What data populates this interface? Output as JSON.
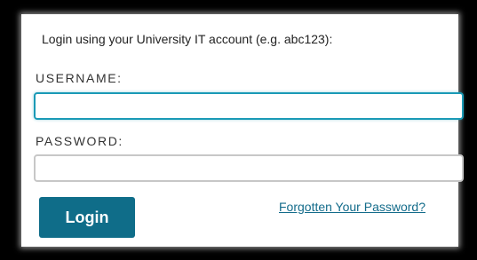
{
  "login_panel": {
    "intro_text": "Login using your University IT account (e.g. abc123):",
    "username": {
      "label": "USERNAME:",
      "value": "",
      "placeholder": ""
    },
    "password": {
      "label": "PASSWORD:",
      "value": "",
      "placeholder": ""
    },
    "login_button_label": "Login",
    "forgot_password_link": "Forgotten Your Password?"
  },
  "colors": {
    "frame": "#000000",
    "panel": "#ffffff",
    "accent_focus": "#1a9ab6",
    "button": "#0f6d89",
    "link": "#146c8b"
  }
}
